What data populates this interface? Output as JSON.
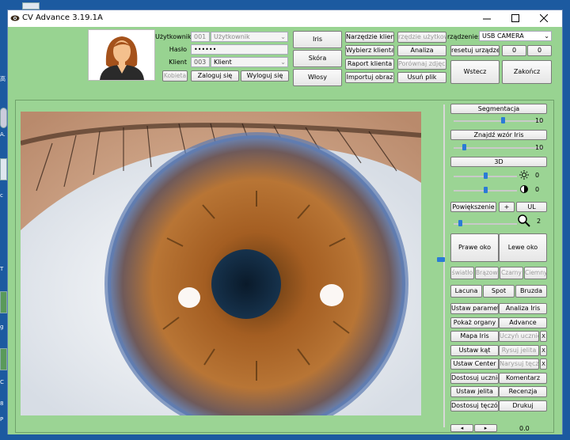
{
  "window": {
    "title": "CV Advance 3.19.1A"
  },
  "desktop": {
    "labels": [
      "高",
      "A.",
      "c",
      "T",
      "g",
      "C",
      "8",
      "P"
    ]
  },
  "login": {
    "user_label": "Użytkownik",
    "user_id": "001",
    "user_name": "Użytkownik",
    "password_label": "Hasło",
    "password_value": "••••••",
    "client_label": "Klient",
    "client_id": "003",
    "client_name": "Klient",
    "gender_button": "Kobieta",
    "login_button": "Zaloguj się",
    "logout_button": "Wyloguj się"
  },
  "top_buttons": {
    "iris": "Iris",
    "skin": "Skóra",
    "hair": "Włosy",
    "client_tool": "Narzędzie klienta",
    "select_client": "Wybierz klienta",
    "client_report": "Raport klienta",
    "import_image": "Importuj obraz",
    "user_tool": "rzędzie użytkown",
    "analysis": "Analiza",
    "compare_photo": "Porównaj zdjęcie",
    "delete_file": "Usuń plik",
    "device_label": "rządzenie:",
    "device_value": "USB CAMERA",
    "reset_device": "resetuj urządzeni",
    "counter_a": "0",
    "counter_b": "0",
    "back": "Wstecz",
    "finish": "Zakończ"
  },
  "controls": {
    "segmentation": "Segmentacja",
    "segmentation_value": "10",
    "segmentation_level": 0.55,
    "find_iris": "Znajdź wzór Iris",
    "find_iris_value": "10",
    "find_iris_level": 0.12,
    "three_d": "3D",
    "brightness_icon": "sun-icon",
    "brightness_value": "0",
    "brightness_level": 0.5,
    "contrast_icon": "contrast-icon",
    "contrast_value": "0",
    "contrast_level": 0.5,
    "zoom": "Powiększenie",
    "plus": "+",
    "ul": "UL",
    "zoom_icon": "magnifier-icon",
    "zoom_value": "2",
    "zoom_level": 0.1,
    "right_eye": "Prawe oko",
    "left_eye": "Lewe oko",
    "color_buttons": [
      "światło",
      "Brązowy",
      "Czarny",
      "Ciemny"
    ],
    "mark_buttons": [
      "Lacuna",
      "Spot",
      "Bruzda"
    ],
    "rows": [
      {
        "left": "Ustaw parametr",
        "right": "Analiza Iris",
        "x": ""
      },
      {
        "left": "Pokaż organy",
        "right": "Advance",
        "x": ""
      },
      {
        "left": "Mapa Iris",
        "right": "Uczyń uczniów",
        "x": "X"
      },
      {
        "left": "Ustaw kąt",
        "right": "Rysuj jelita",
        "x": "X"
      },
      {
        "left": "Ustaw Center",
        "right": "Narysuj tęczówkę",
        "x": "X"
      },
      {
        "left": "Dostosuj uczniów",
        "right": "Komentarz",
        "x": ""
      },
      {
        "left": "Ustaw jelita",
        "right": "Recenzja",
        "x": ""
      },
      {
        "left": "Dostosuj tęczówkę",
        "right": "Drukuj",
        "x": ""
      }
    ],
    "bottom_value": "0.0",
    "prev_arrow": "◂",
    "next_arrow": "▸"
  }
}
